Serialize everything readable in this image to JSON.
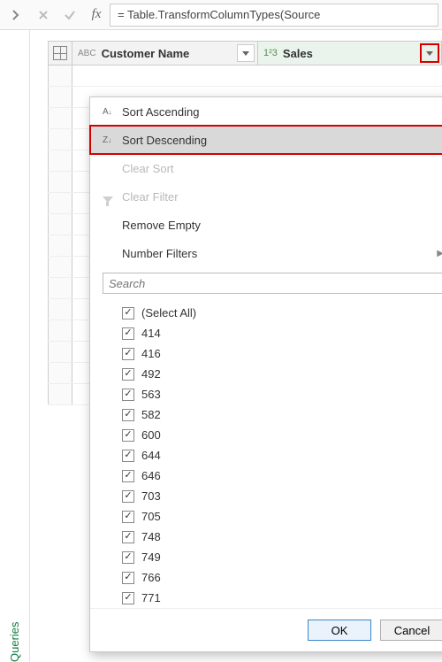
{
  "rail": {
    "label": "Queries"
  },
  "formula": {
    "fx_label": "fx",
    "text": "= Table.TransformColumnTypes(Source"
  },
  "columns": {
    "customer": {
      "type_glyph": "ABC",
      "name": "Customer Name"
    },
    "sales": {
      "type_glyph": "1²3",
      "name": "Sales"
    }
  },
  "dropdown": {
    "sort_asc": "Sort Ascending",
    "sort_desc": "Sort Descending",
    "clear_sort": "Clear Sort",
    "clear_filter": "Clear Filter",
    "remove_empty": "Remove Empty",
    "number_filters": "Number Filters",
    "search_placeholder": "Search",
    "select_all": "(Select All)",
    "values": [
      "414",
      "416",
      "492",
      "563",
      "582",
      "600",
      "644",
      "646",
      "703",
      "705",
      "748",
      "749",
      "766",
      "771"
    ],
    "ok": "OK",
    "cancel": "Cancel"
  },
  "icons": {
    "asc": "A↓Z",
    "desc": "Z↓A"
  }
}
